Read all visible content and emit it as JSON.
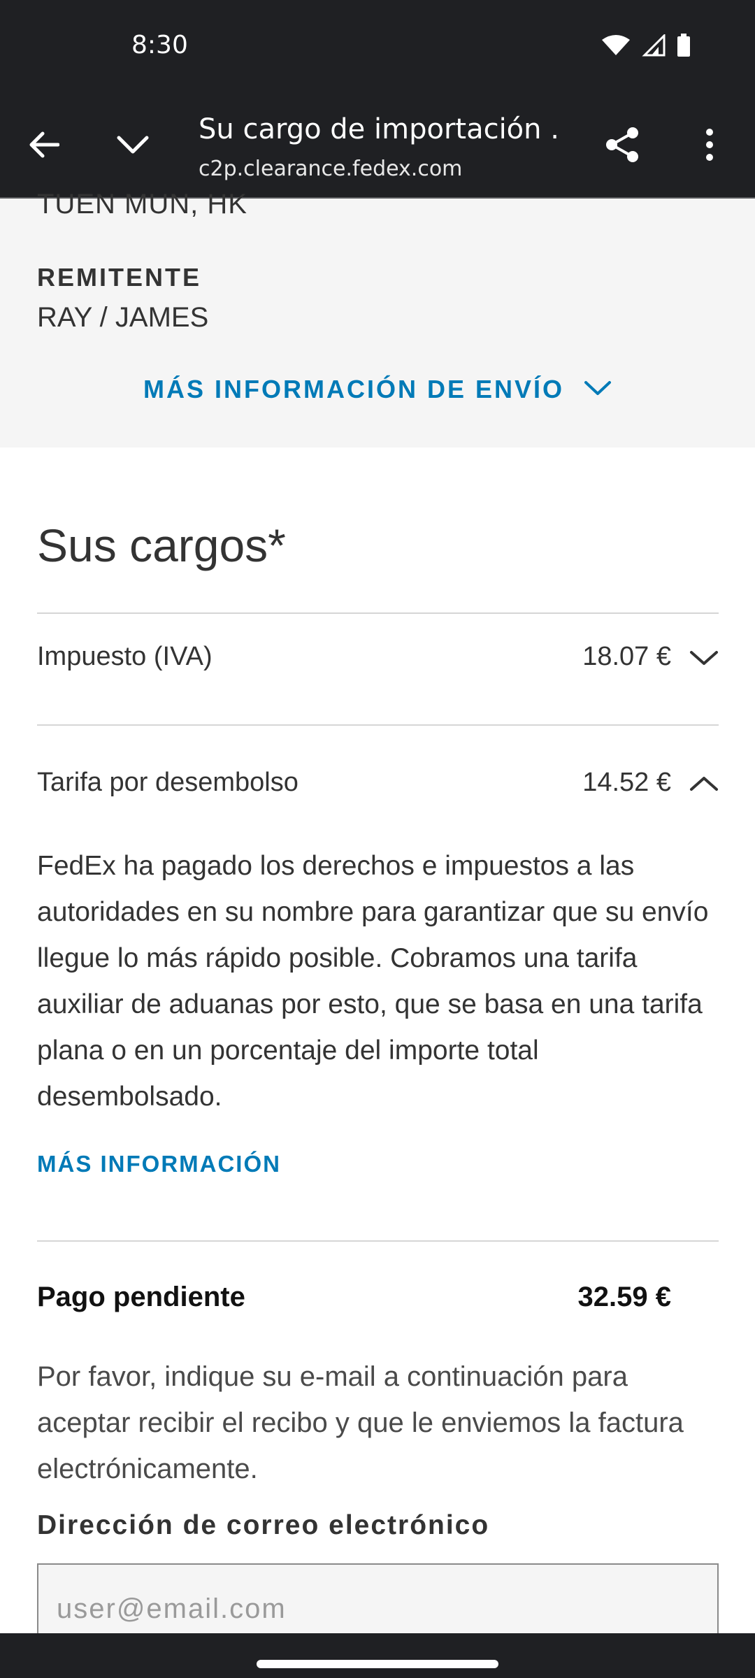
{
  "status_bar": {
    "time": "8:30",
    "icons": [
      "wifi-icon",
      "signal-icon",
      "battery-icon"
    ]
  },
  "toolbar": {
    "title": "Su cargo de importación ...",
    "url": "c2p.clearance.fedex.com",
    "icons": [
      "back-arrow-icon",
      "chevron-down-icon",
      "share-icon",
      "more-vert-icon"
    ]
  },
  "shipment": {
    "cut_off_line": "TUEN MUN, HK",
    "sender_label": "REMITENTE",
    "sender_value": "RAY / JAMES",
    "more_shipping_info": "MÁS INFORMACIÓN DE ENVÍO"
  },
  "charges": {
    "title": "Sus cargos*",
    "rows": [
      {
        "label": "Impuesto (IVA)",
        "amount": "18.07 €",
        "expanded": false
      },
      {
        "label": "Tarifa por desembolso",
        "amount": "14.52 €",
        "expanded": true
      }
    ],
    "description": "FedEx ha pagado los derechos e impuestos a las autoridades en su nombre para garantizar que su envío llegue lo más rápido posible. Cobramos una tarifa auxiliar de aduanas por esto, que se basa en una tarifa plana o en un porcentaje del importe total desembolsado.",
    "more_info": "MÁS INFORMACIÓN"
  },
  "pending": {
    "label": "Pago pendiente",
    "amount": "32.59 €"
  },
  "email": {
    "note": "Por favor, indique su e-mail a continuación para aceptar recibir el recibo y que le enviemos la factura electrónicamente.",
    "label": "Dirección de correo electrónico",
    "placeholder": "user@email.com",
    "value": ""
  },
  "colors": {
    "accent": "#007ab7",
    "chrome": "#1f2023"
  }
}
